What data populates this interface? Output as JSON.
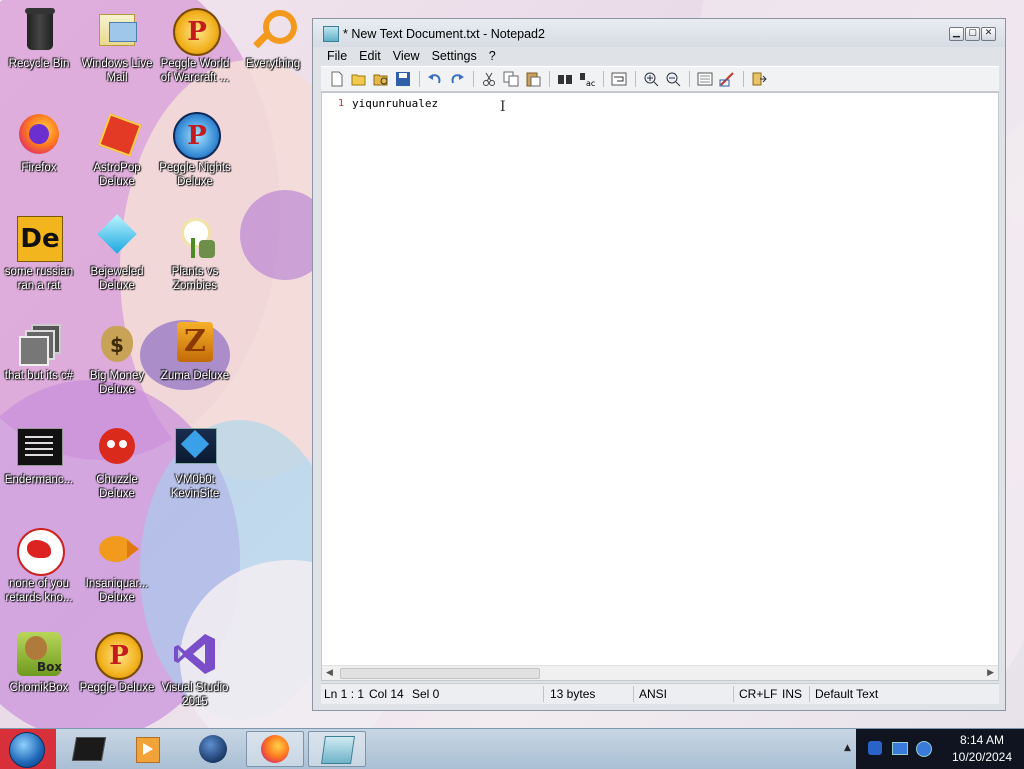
{
  "desktop": {
    "icons": [
      {
        "label": "Recycle Bin",
        "icon": "recycle-bin-icon"
      },
      {
        "label": "Windows Live Mail",
        "icon": "mail-icon"
      },
      {
        "label": "Peggle World of Warcraft ...",
        "icon": "peggle-icon"
      },
      {
        "label": "Everything",
        "icon": "magnifier-icon"
      },
      {
        "label": "Firefox",
        "icon": "firefox-icon"
      },
      {
        "label": "AstroPop Deluxe",
        "icon": "astropop-icon"
      },
      {
        "label": "Peggle Nights Deluxe",
        "icon": "peggle-icon"
      },
      {
        "label": "some russian ran a rat",
        "icon": "de-icon"
      },
      {
        "label": "Bejeweled Deluxe",
        "icon": "gem-icon"
      },
      {
        "label": "Plants vs Zombies",
        "icon": "plant-icon"
      },
      {
        "label": "that but its c#",
        "icon": "windows-stack-icon"
      },
      {
        "label": "Big Money Deluxe",
        "icon": "money-bag-icon"
      },
      {
        "label": "Zuma Deluxe",
        "icon": "zuma-icon"
      },
      {
        "label": "Endermanc...",
        "icon": "console-icon"
      },
      {
        "label": "Chuzzle Deluxe",
        "icon": "chuzzle-icon"
      },
      {
        "label": "VM0b0t KevinSite",
        "icon": "vm-icon"
      },
      {
        "label": "none of you retards kno...",
        "icon": "dragon-icon"
      },
      {
        "label": "Insaniquar... Deluxe",
        "icon": "fish-icon"
      },
      {
        "label": "ChomikBox",
        "icon": "chomikbox-icon"
      },
      {
        "label": "Peggle Deluxe",
        "icon": "peggle-icon"
      },
      {
        "label": "Visual Studio 2015",
        "icon": "visual-studio-icon"
      }
    ]
  },
  "window": {
    "title": "* New Text Document.txt - Notepad2",
    "menu": [
      "File",
      "Edit",
      "View",
      "Settings",
      "?"
    ],
    "toolbar_icons": [
      "new-file-icon",
      "open-icon",
      "browse-icon",
      "save-icon",
      "undo-icon",
      "redo-icon",
      "cut-icon",
      "copy-icon",
      "paste-icon",
      "find-icon",
      "replace-icon",
      "word-wrap-icon",
      "zoom-in-icon",
      "zoom-out-icon",
      "scheme-icon",
      "customize-icon",
      "exit-icon"
    ],
    "editor": {
      "line_number": "1",
      "content": "yiqunruhualez"
    },
    "status": {
      "position": "Ln 1 : 1",
      "column": "Col 14",
      "selection": "Sel 0",
      "size": "13 bytes",
      "encoding": "ANSI",
      "line_endings": "CR+LF",
      "insert_mode": "INS",
      "scheme": "Default Text"
    }
  },
  "taskbar": {
    "buttons": [
      "terminal-icon",
      "media-player-icon",
      "globe-icon",
      "firefox-icon",
      "notepad-icon"
    ],
    "clock": {
      "time": "8:14 AM",
      "date": "10/20/2024"
    }
  },
  "colors": {
    "start_button": "#d7303a",
    "line_number": "#c03030"
  }
}
